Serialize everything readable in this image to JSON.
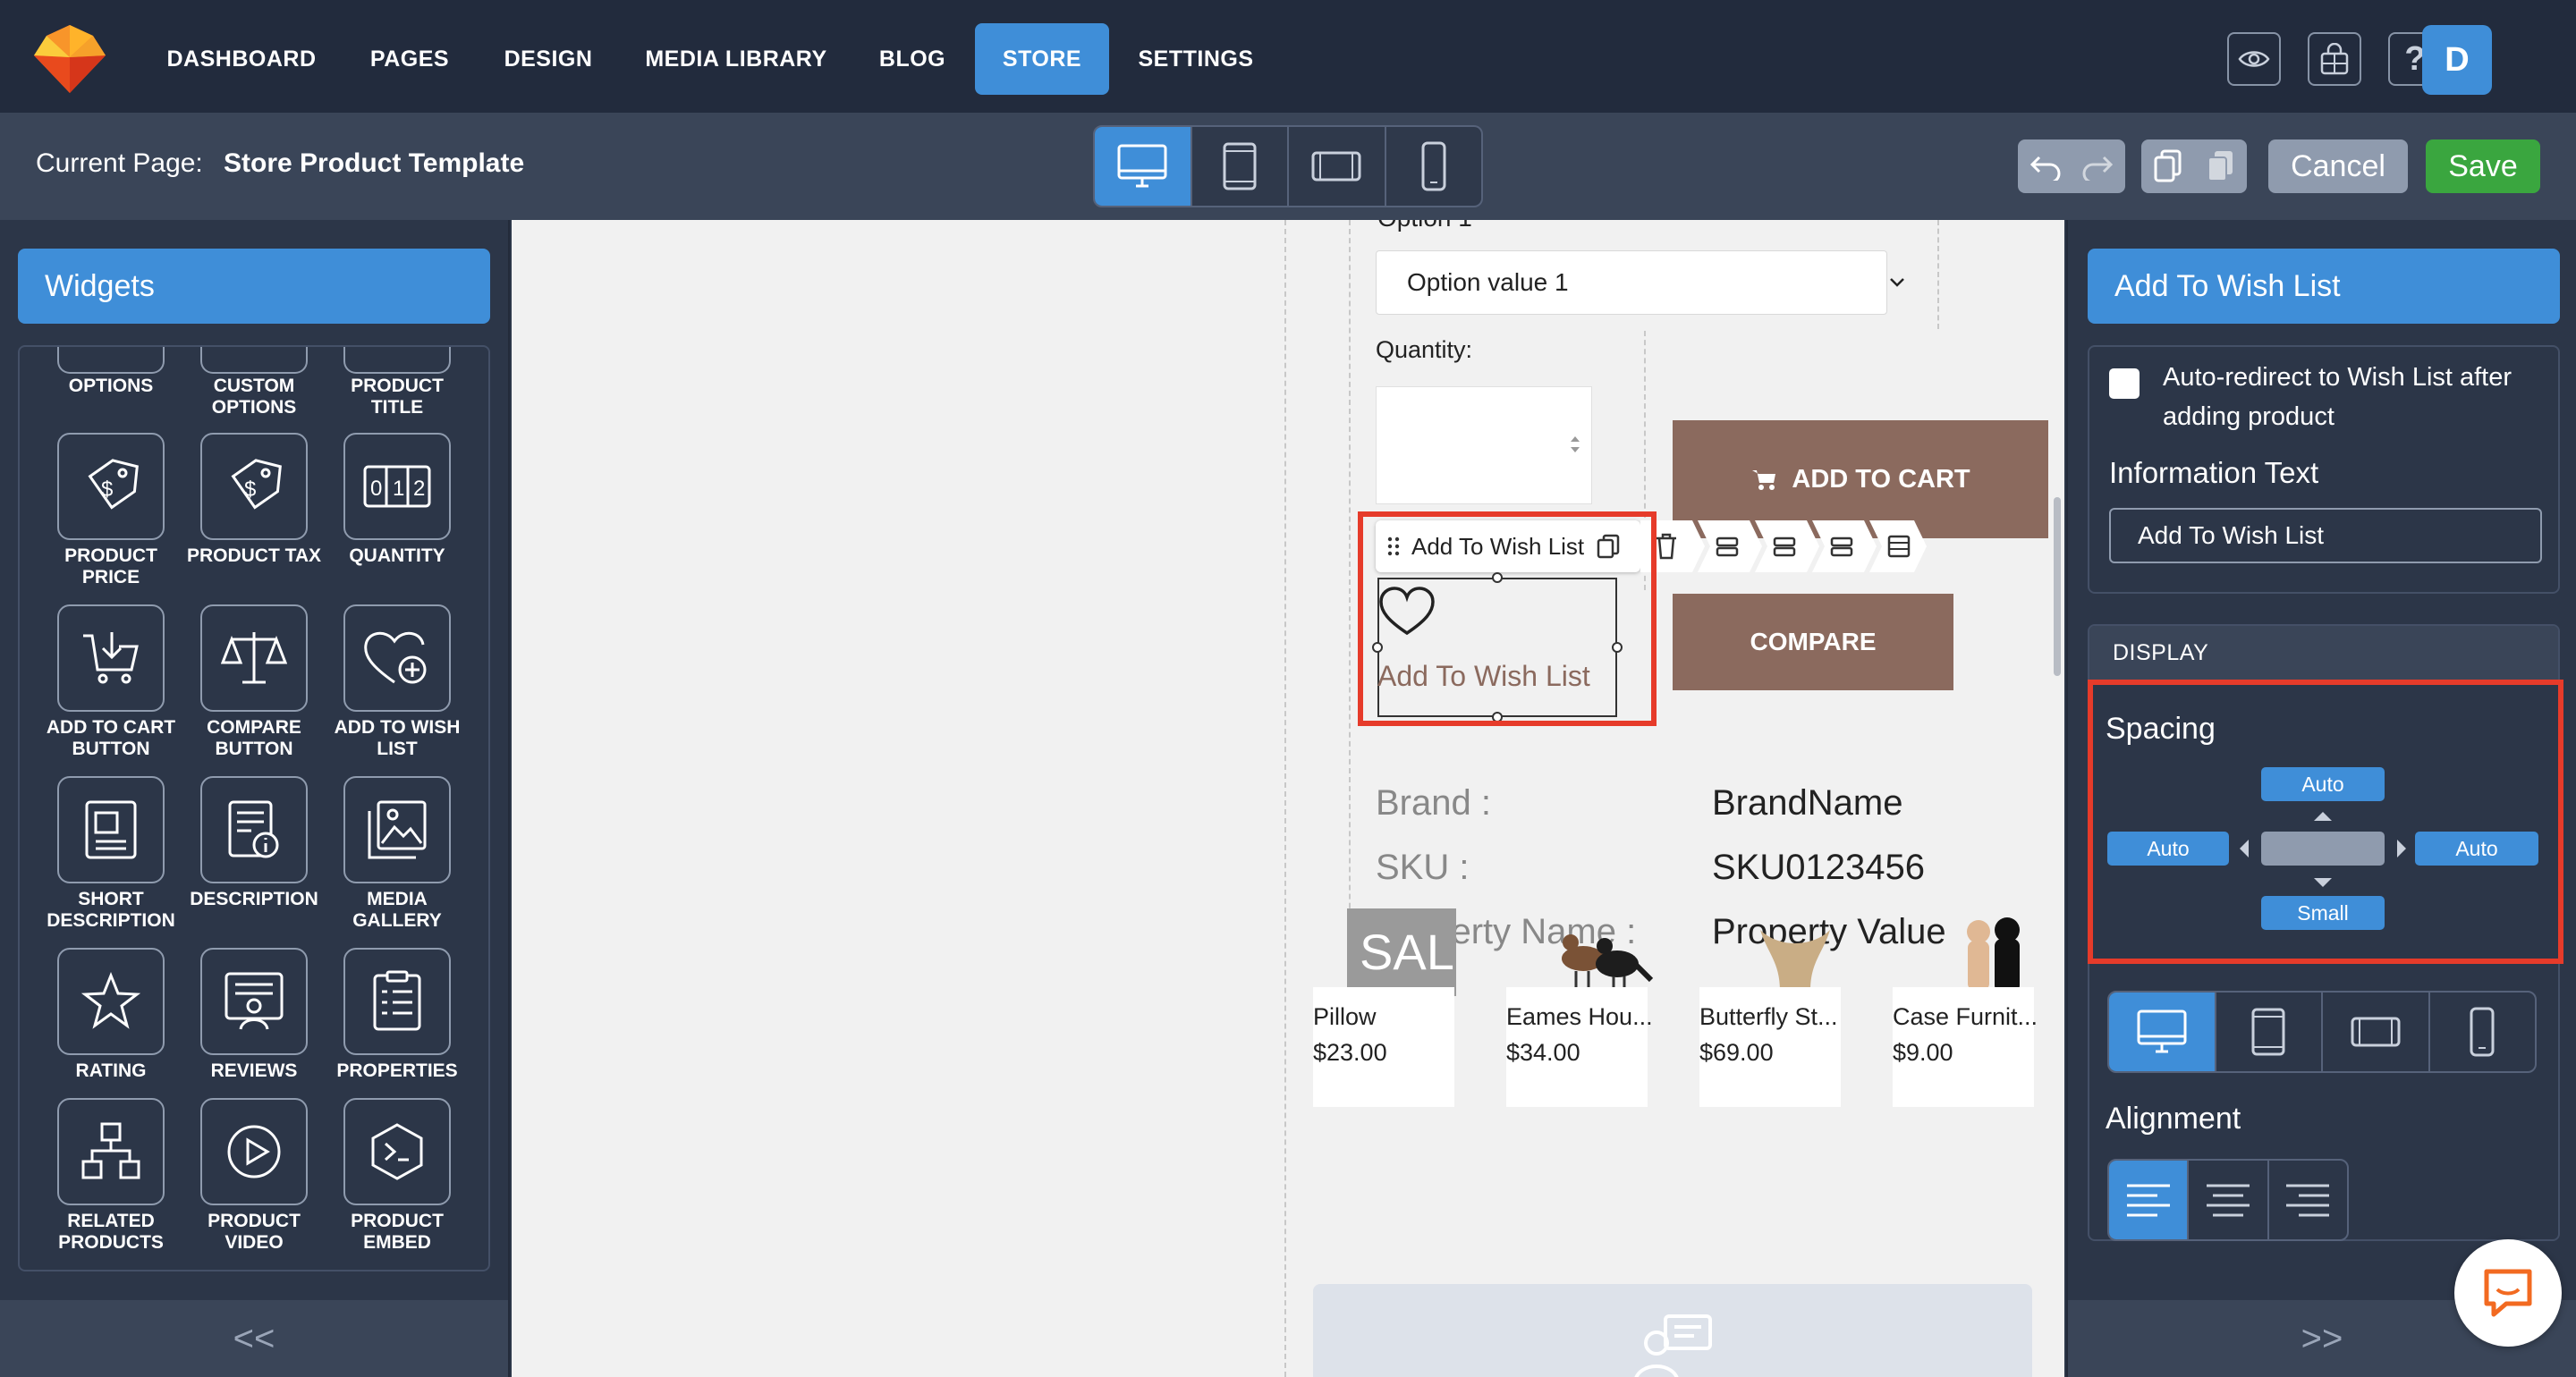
{
  "nav": {
    "items": [
      {
        "label": "DASHBOARD"
      },
      {
        "label": "PAGES"
      },
      {
        "label": "DESIGN"
      },
      {
        "label": "MEDIA LIBRARY"
      },
      {
        "label": "BLOG"
      },
      {
        "label": "STORE",
        "active": true
      },
      {
        "label": "SETTINGS"
      }
    ],
    "icons": [
      "eye-icon",
      "lock-grid-icon",
      "help-icon"
    ],
    "user_initial": "D"
  },
  "subheader": {
    "current_page_label": "Current Page:",
    "current_page_name": "Store Product Template",
    "devices": [
      "desktop-icon",
      "tablet-portrait-icon",
      "tablet-landscape-icon",
      "mobile-icon"
    ],
    "active_device": "desktop",
    "cancel_label": "Cancel",
    "save_label": "Save"
  },
  "widgets": {
    "title": "Widgets",
    "top_row": [
      "OPTIONS",
      "CUSTOM OPTIONS",
      "PRODUCT TITLE"
    ],
    "items": [
      {
        "label": "PRODUCT PRICE",
        "icon": "price-tag-icon"
      },
      {
        "label": "PRODUCT TAX",
        "icon": "tax-tag-icon"
      },
      {
        "label": "QUANTITY",
        "icon": "quantity-counter-icon"
      },
      {
        "label": "ADD TO CART BUTTON",
        "icon": "cart-download-icon"
      },
      {
        "label": "COMPARE BUTTON",
        "icon": "scale-icon"
      },
      {
        "label": "ADD TO WISH LIST",
        "icon": "heart-plus-icon"
      },
      {
        "label": "SHORT DESCRIPTION",
        "icon": "document-icon"
      },
      {
        "label": "DESCRIPTION",
        "icon": "document-info-icon"
      },
      {
        "label": "MEDIA GALLERY",
        "icon": "image-gallery-icon"
      },
      {
        "label": "RATING",
        "icon": "star-icon"
      },
      {
        "label": "REVIEWS",
        "icon": "review-icon"
      },
      {
        "label": "PROPERTIES",
        "icon": "list-icon"
      },
      {
        "label": "RELATED PRODUCTS",
        "icon": "hierarchy-icon"
      },
      {
        "label": "PRODUCT VIDEO",
        "icon": "play-icon"
      },
      {
        "label": "PRODUCT EMBED",
        "icon": "code-embed-icon"
      }
    ],
    "collapse": "<<"
  },
  "canvas": {
    "option_label": "Option 1",
    "option_value": "Option value 1",
    "quantity_label": "Quantity:",
    "add_to_cart": "ADD TO CART",
    "compare": "COMPARE",
    "toolbar_label": "Add To Wish List",
    "wishlist_text": "Add To Wish List",
    "properties": [
      {
        "label": "Brand :",
        "value": "BrandName"
      },
      {
        "label": "SKU :",
        "value": "SKU0123456"
      },
      {
        "label": "Property Name :",
        "value": "Property Value"
      }
    ],
    "products": [
      {
        "name": "Pillow",
        "price": "$23.00",
        "image_text": "SAL"
      },
      {
        "name": "Eames Hou...",
        "price": "$34.00"
      },
      {
        "name": "Butterfly St...",
        "price": "$69.00"
      },
      {
        "name": "Case Furnit...",
        "price": "$9.00"
      }
    ]
  },
  "props": {
    "title": "Add To Wish List",
    "redirect_label": "Auto-redirect to Wish List after adding product",
    "info_text_label": "Information Text",
    "info_text_value": "Add To Wish List",
    "display_header": "DISPLAY",
    "spacing_label": "Spacing",
    "spacing": {
      "top": "Auto",
      "left": "Auto",
      "right": "Auto",
      "bottom": "Small"
    },
    "alignment_label": "Alignment",
    "alignment_active": "left",
    "collapse": ">>"
  },
  "colors": {
    "accent": "#3f8ed8",
    "product_brown": "#8b6a5e",
    "save_green": "#3aa63f",
    "highlight_red": "#e63b2a"
  }
}
